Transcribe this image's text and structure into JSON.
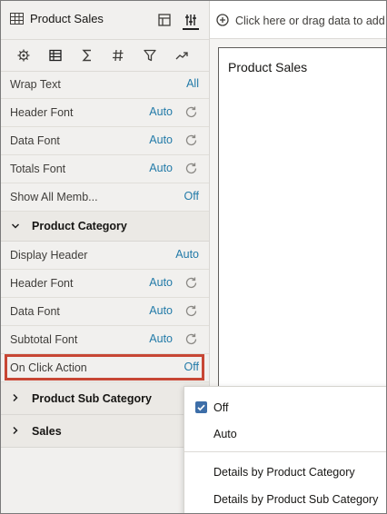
{
  "panel": {
    "title": "Product Sales"
  },
  "drop_zone": {
    "text": "Click here or drag data to add"
  },
  "canvas": {
    "viz_title": "Product Sales"
  },
  "properties": {
    "general_rows": [
      {
        "label": "Wrap Text",
        "value": "All",
        "reset": false
      },
      {
        "label": "Header Font",
        "value": "Auto",
        "reset": true
      },
      {
        "label": "Data Font",
        "value": "Auto",
        "reset": true
      },
      {
        "label": "Totals Font",
        "value": "Auto",
        "reset": true
      },
      {
        "label": "Show All Memb...",
        "value": "Off",
        "reset": false
      }
    ],
    "sections": [
      {
        "label": "Product Category",
        "rows": [
          {
            "label": "Display Header",
            "value": "Auto",
            "reset": false
          },
          {
            "label": "Header Font",
            "value": "Auto",
            "reset": true
          },
          {
            "label": "Data Font",
            "value": "Auto",
            "reset": true
          },
          {
            "label": "Subtotal Font",
            "value": "Auto",
            "reset": true
          },
          {
            "label": "On Click Action",
            "value": "Off",
            "reset": false
          }
        ]
      },
      {
        "label": "Product Sub Category"
      },
      {
        "label": "Sales"
      }
    ]
  },
  "dropdown": {
    "options": [
      {
        "label": "Off",
        "selected": true
      },
      {
        "label": "Auto",
        "selected": false
      },
      {
        "label": "Details by Product Category",
        "selected": false
      },
      {
        "label": "Details by Product Sub Category",
        "selected": false
      }
    ]
  },
  "colors": {
    "value_link": "#227aa8",
    "highlight": "#c74634",
    "check": "#3d6ea8"
  }
}
